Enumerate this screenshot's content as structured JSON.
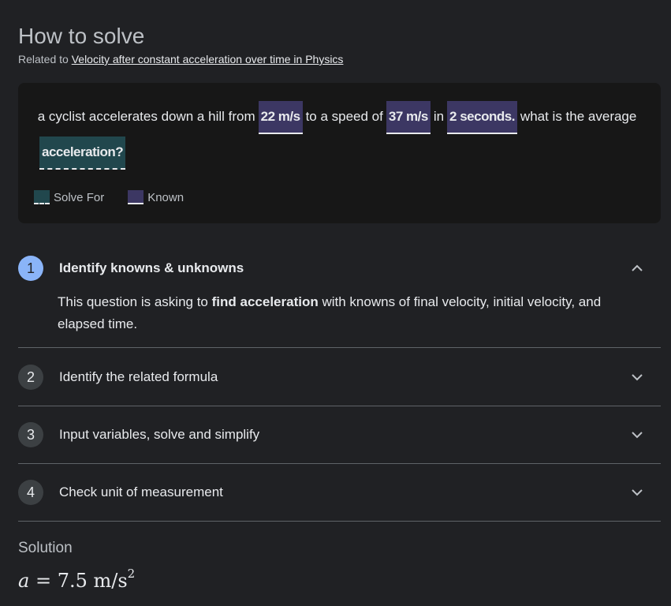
{
  "header": {
    "title": "How to solve",
    "related_prefix": "Related to",
    "related_link": "Velocity after constant acceleration over time in Physics"
  },
  "problem": {
    "t1": "a cyclist accelerates down a hill from",
    "k1": "22 m/s",
    "t2": "to a speed of",
    "k2": "37 m/s",
    "t3": "in",
    "k3": "2 seconds.",
    "t4": "what is the average",
    "s1": "acceleration?"
  },
  "legend": {
    "solve_for": "Solve For",
    "known": "Known",
    "colors": {
      "solve_for": "#21474d",
      "known": "#3c3763"
    }
  },
  "steps": [
    {
      "number": "1",
      "label": "Identify knowns & unknowns",
      "expanded": true,
      "body_prefix": "This question is asking to",
      "body_bold": "find acceleration",
      "body_suffix": "with knowns of final velocity, initial velocity, and elapsed time."
    },
    {
      "number": "2",
      "label": "Identify the related formula",
      "expanded": false
    },
    {
      "number": "3",
      "label": "Input variables, solve and simplify",
      "expanded": false
    },
    {
      "number": "4",
      "label": "Check unit of measurement",
      "expanded": false
    }
  ],
  "solution": {
    "title": "Solution",
    "var": "a",
    "equals": "=",
    "value": "7.5 m/s",
    "exponent": "2"
  }
}
